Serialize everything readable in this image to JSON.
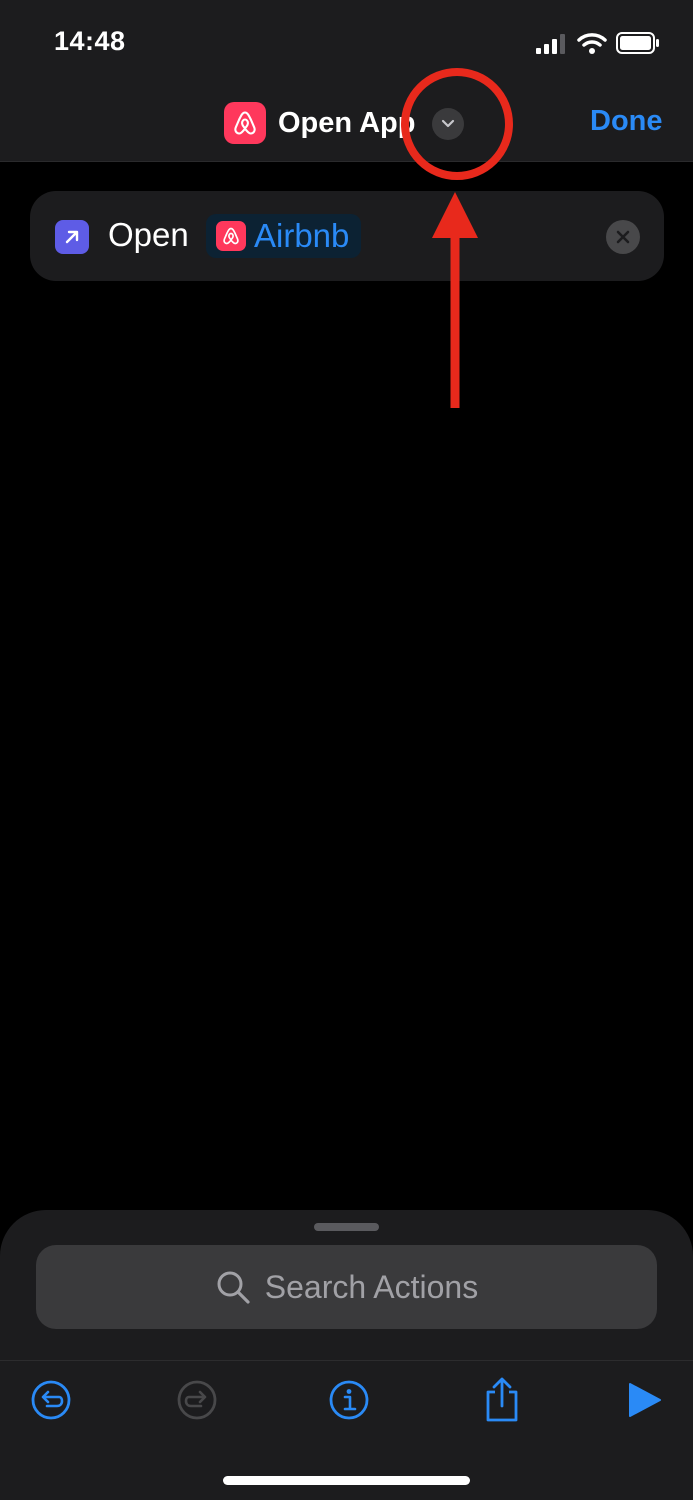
{
  "status_bar": {
    "time": "14:48"
  },
  "nav": {
    "title": "Open App",
    "app_icon": "airbnb-icon",
    "done_label": "Done",
    "accent_color": "#2a8af6",
    "app_color": "#ff385c"
  },
  "action": {
    "verb": "Open",
    "app_name": "Airbnb",
    "icon": "open-arrow-icon",
    "remove_icon": "close-icon"
  },
  "bottom_sheet": {
    "search_placeholder": "Search Actions",
    "toolbar": [
      "undo-icon",
      "redo-icon",
      "info-icon",
      "share-icon",
      "play-icon"
    ]
  }
}
